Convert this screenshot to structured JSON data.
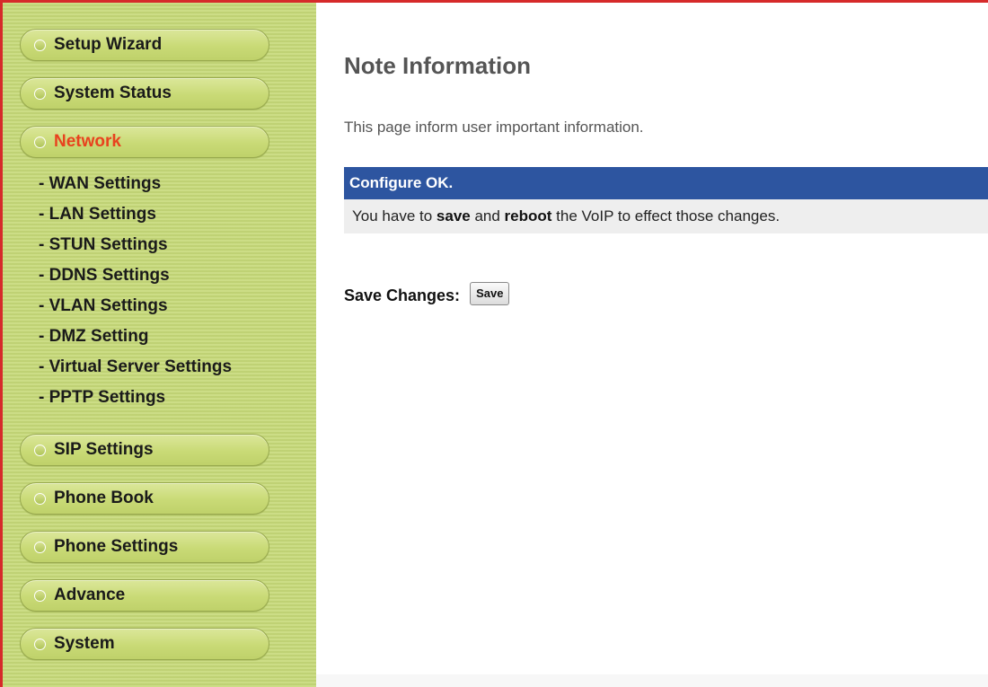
{
  "sidebar": {
    "top_buttons": [
      {
        "label": "Setup Wizard"
      },
      {
        "label": "System Status"
      },
      {
        "label": "Network"
      }
    ],
    "network_submenu": [
      {
        "label": "- WAN Settings"
      },
      {
        "label": "- LAN Settings"
      },
      {
        "label": "- STUN Settings"
      },
      {
        "label": "- DDNS Settings"
      },
      {
        "label": "- VLAN Settings"
      },
      {
        "label": "- DMZ Setting"
      },
      {
        "label": "- Virtual Server Settings"
      },
      {
        "label": "- PPTP Settings"
      }
    ],
    "bottom_buttons": [
      {
        "label": "SIP Settings"
      },
      {
        "label": "Phone Book"
      },
      {
        "label": "Phone Settings"
      },
      {
        "label": "Advance"
      },
      {
        "label": "System"
      }
    ]
  },
  "main": {
    "title": "Note Information",
    "description": "This page inform user important information.",
    "note": {
      "header": "Configure OK.",
      "body_prefix": "You have to ",
      "body_bold1": "save",
      "body_mid": " and ",
      "body_bold2": "reboot",
      "body_suffix": " the VoIP to effect those changes."
    },
    "save_label": "Save Changes:",
    "save_button": "Save"
  },
  "colors": {
    "sidebar_bg": "#c6d978",
    "active_menu_text": "#e8421e",
    "note_header_bg": "#2d55a0",
    "note_body_bg": "#eeeeee",
    "frame_border": "#d62a2a"
  }
}
